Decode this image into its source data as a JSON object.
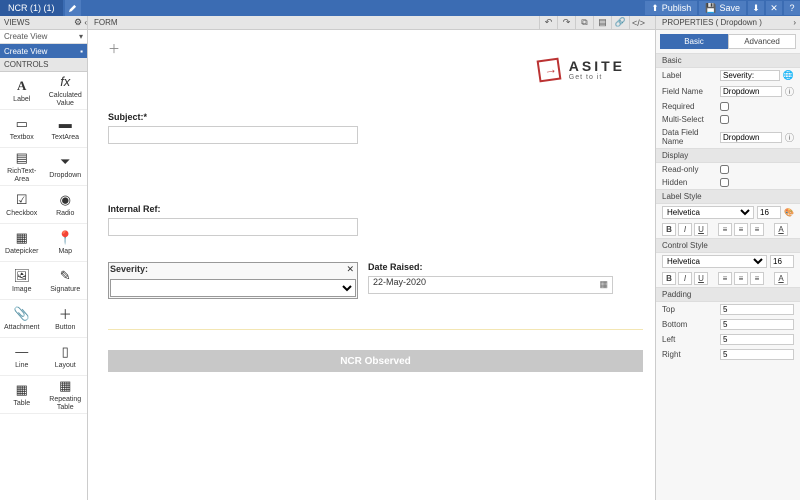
{
  "topbar": {
    "tab_label": "NCR (1) (1)",
    "publish_label": "Publish",
    "save_label": "Save"
  },
  "subbar": {
    "views_label": "VIEWS",
    "form_label": "FORM",
    "props_label": "PROPERTIES  ( Dropdown )"
  },
  "left": {
    "create_view": "Create View",
    "view_item": "Create View",
    "controls_label": "CONTROLS",
    "controls": [
      {
        "icon": "A",
        "label": "Label"
      },
      {
        "icon": "fx",
        "label": "Calculated Value"
      },
      {
        "icon": "▭",
        "label": "Textbox"
      },
      {
        "icon": "▬",
        "label": "TextArea"
      },
      {
        "icon": "▤",
        "label": "RichText-Area"
      },
      {
        "icon": "⏷",
        "label": "Dropdown"
      },
      {
        "icon": "☑",
        "label": "Checkbox"
      },
      {
        "icon": "◉",
        "label": "Radio"
      },
      {
        "icon": "▦",
        "label": "Datepicker"
      },
      {
        "icon": "📍",
        "label": "Map"
      },
      {
        "icon": "🖼",
        "label": "Image"
      },
      {
        "icon": "✎",
        "label": "Signature"
      },
      {
        "icon": "📎",
        "label": "Attachment"
      },
      {
        "icon": "＋",
        "label": "Button"
      },
      {
        "icon": "—",
        "label": "Line"
      },
      {
        "icon": "▯",
        "label": "Layout"
      },
      {
        "icon": "▦",
        "label": "Table"
      },
      {
        "icon": "▦",
        "label": "Repeating Table"
      }
    ]
  },
  "canvas": {
    "logo_brand": "ASITE",
    "logo_tag": "Get to it",
    "subject_label": "Subject:*",
    "internal_ref_label": "Internal Ref:",
    "severity_label": "Severity:",
    "date_raised_label": "Date Raised:",
    "date_raised_value": "22-May-2020",
    "ncr_label": "NCR Observed"
  },
  "props": {
    "tab_basic": "Basic",
    "tab_advanced": "Advanced",
    "sec_basic": "Basic",
    "label_lbl": "Label",
    "label_val": "Severity:",
    "fieldname_lbl": "Field Name",
    "fieldname_val": "Dropdown",
    "required_lbl": "Required",
    "multiselect_lbl": "Multi-Select",
    "datafield_lbl": "Data Field Name",
    "datafield_val": "Dropdown",
    "sec_display": "Display",
    "readonly_lbl": "Read-only",
    "hidden_lbl": "Hidden",
    "sec_labelstyle": "Label Style",
    "font_label": "Helvetica",
    "font_size_label": "16",
    "sec_controlstyle": "Control Style",
    "font_control": "Helvetica",
    "font_size_control": "16",
    "sec_padding": "Padding",
    "pad_top_lbl": "Top",
    "pad_top_val": "5",
    "pad_bottom_lbl": "Bottom",
    "pad_bottom_val": "5",
    "pad_left_lbl": "Left",
    "pad_left_val": "5",
    "pad_right_lbl": "Right",
    "pad_right_val": "5"
  }
}
